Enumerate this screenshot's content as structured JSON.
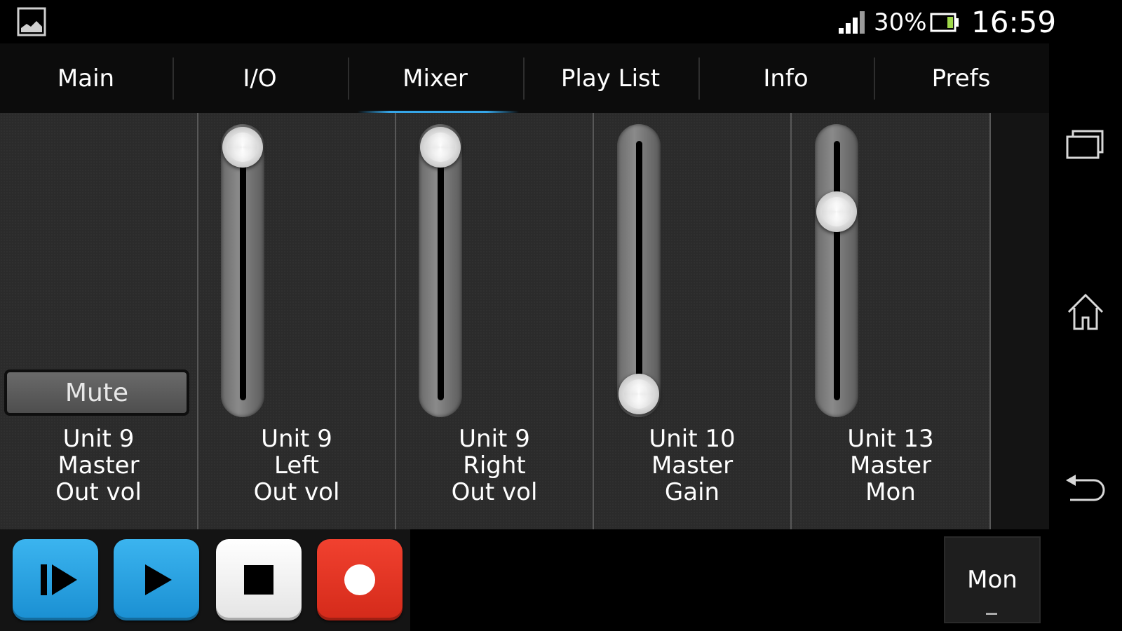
{
  "status": {
    "battery_pct": "30%",
    "clock": "16:59",
    "icons": [
      "gallery-icon",
      "signal-icon",
      "battery-icon"
    ]
  },
  "tabs": [
    {
      "label": "Main"
    },
    {
      "label": "I/O"
    },
    {
      "label": "Mixer",
      "selected": true
    },
    {
      "label": "Play List"
    },
    {
      "label": "Info"
    },
    {
      "label": "Prefs"
    }
  ],
  "channels": [
    {
      "line1": "Unit 9",
      "line2": "Master",
      "line3": "Out vol",
      "button": "Mute"
    },
    {
      "line1": "Unit 9",
      "line2": "Left",
      "line3": "Out vol",
      "fader_level": 1.0
    },
    {
      "line1": "Unit 9",
      "line2": "Right",
      "line3": "Out vol",
      "fader_level": 1.0
    },
    {
      "line1": "Unit 10",
      "line2": "Master",
      "line3": "Gain",
      "fader_level": 0.0
    },
    {
      "line1": "Unit 13",
      "line2": "Master",
      "line3": "Mon",
      "fader_level": 0.74
    }
  ],
  "transport": {
    "buttons": [
      "skip-play-icon",
      "play-icon",
      "stop-icon",
      "record-icon"
    ],
    "mon_label": "Mon"
  },
  "nav_icons": [
    "recent-apps-icon",
    "home-icon",
    "back-icon"
  ],
  "colors": {
    "accent": "#36a6e8",
    "play_blue": "#1f98dc",
    "record_red": "#e3321f"
  }
}
